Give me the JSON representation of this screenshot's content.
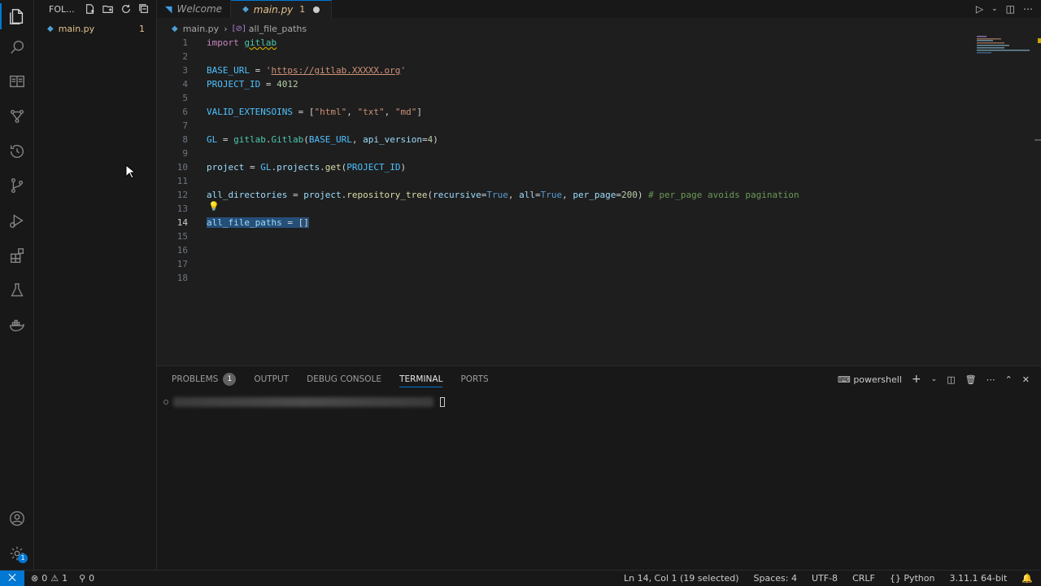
{
  "sidebar": {
    "title": "FOL...",
    "files": [
      {
        "name": "main.py",
        "problems": "1"
      }
    ]
  },
  "tabs": [
    {
      "label": "Welcome",
      "active": false
    },
    {
      "label": "main.py",
      "problem_count": "1",
      "active": true,
      "unsaved": true
    }
  ],
  "breadcrumb": {
    "file": "main.py",
    "symbol": "all_file_paths"
  },
  "editor": {
    "line_numbers": [
      "1",
      "2",
      "3",
      "4",
      "5",
      "6",
      "7",
      "8",
      "9",
      "10",
      "11",
      "12",
      "13",
      "14",
      "15",
      "16",
      "17",
      "18"
    ],
    "current_line": "14"
  },
  "panel": {
    "tabs": [
      "PROBLEMS",
      "OUTPUT",
      "DEBUG CONSOLE",
      "TERMINAL",
      "PORTS"
    ],
    "problems_badge": "1",
    "active_tab": "TERMINAL",
    "shell": "powershell"
  },
  "status": {
    "errors": "0",
    "warnings": "1",
    "ports": "0",
    "cursor": "Ln 14, Col 1 (19 selected)",
    "spaces": "Spaces: 4",
    "encoding": "UTF-8",
    "eol": "CRLF",
    "language": "Python",
    "interpreter": "3.11.1 64-bit"
  },
  "colors": {
    "accent": "#0078d4",
    "modified": "#e2c08d",
    "background": "#1e1e1e"
  }
}
